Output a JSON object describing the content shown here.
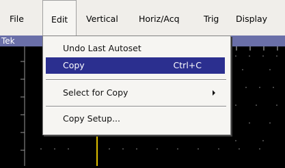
{
  "menubar": {
    "items": [
      "File",
      "Edit",
      "Vertical",
      "Horiz/Acq",
      "Trig",
      "Display"
    ]
  },
  "title": "Tek",
  "dropdown": {
    "items": [
      {
        "label": "Undo Last Autoset",
        "shortcut": ""
      },
      {
        "label": "Copy",
        "shortcut": "Ctrl+C"
      },
      {
        "label": "Select for Copy",
        "shortcut": ""
      },
      {
        "label": "Copy Setup...",
        "shortcut": ""
      }
    ]
  },
  "colors": {
    "menubar_bg": "#f0eeea",
    "highlight": "#2b2f8f",
    "titlebar": "#6a6fa8",
    "screen_bg": "#000000",
    "grid": "#9a9a9a",
    "cursor": "#e0c000"
  }
}
